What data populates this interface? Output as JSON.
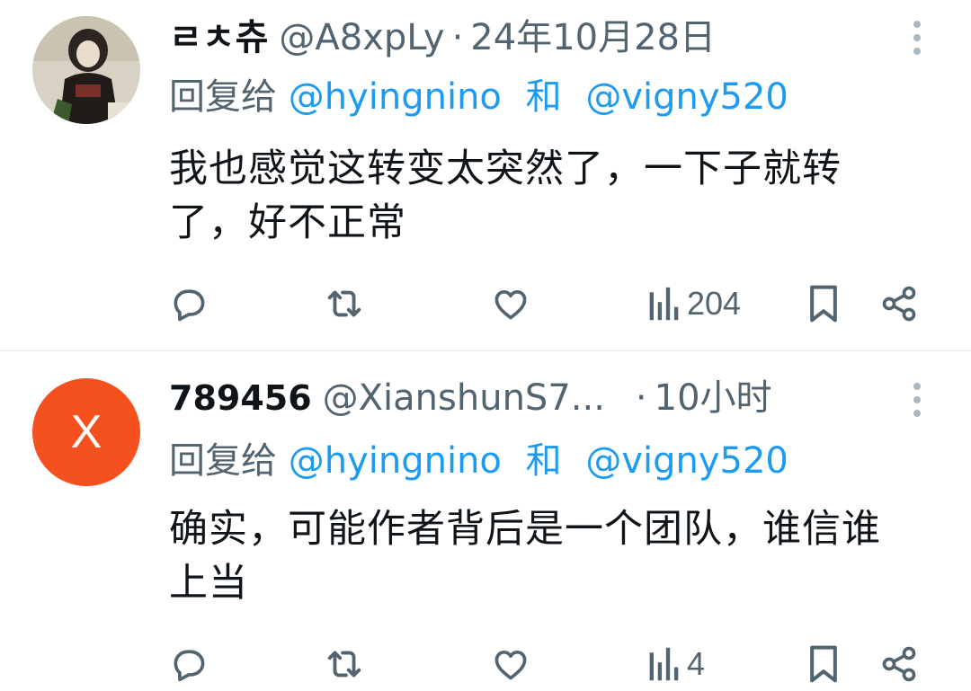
{
  "tweets": [
    {
      "display_name": "ㄹㅊ츄",
      "handle": "@A8xpLy",
      "separator": "·",
      "time": "24年10月28日",
      "reply_prefix": "回复给",
      "mention_1": "@hyingnino",
      "mention_joiner": "和",
      "mention_2": "@vigny520",
      "text": "我也感觉这转变太突然了，一下子就转了，好不正常",
      "views": "204",
      "avatar": "photo-avatar"
    },
    {
      "display_name": "789456",
      "handle": "@XianshunS7...",
      "separator": "·",
      "time": "10小时",
      "reply_prefix": "回复给",
      "mention_1": "@hyingnino",
      "mention_joiner": "和",
      "mention_2": "@vigny520",
      "text": "确实，可能作者背后是一个团队，谁信谁上当",
      "views": "4",
      "avatar_letter": "X",
      "avatar_color": "#f4511e"
    }
  ],
  "colors": {
    "link": "#1d9bf0",
    "secondary_text": "#536471",
    "primary_text": "#0f1419",
    "divider": "#eff3f4"
  },
  "icons": [
    "reply-icon",
    "retweet-icon",
    "like-icon",
    "views-icon",
    "bookmark-icon",
    "share-icon",
    "more-icon"
  ]
}
